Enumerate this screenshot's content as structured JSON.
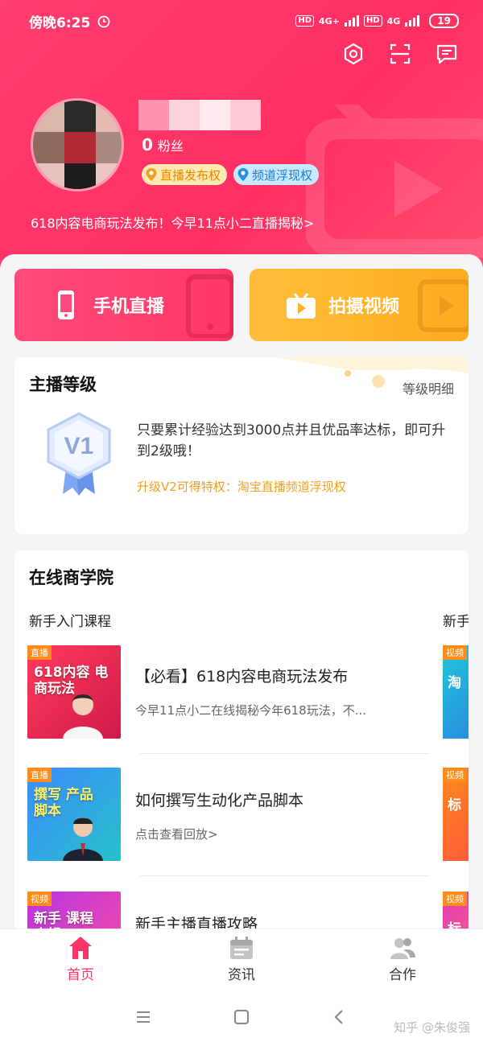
{
  "status_bar": {
    "time": "傍晚6:25",
    "hd1": "HD",
    "net1": "4G+",
    "hd2": "HD",
    "net2": "4G",
    "battery": "19"
  },
  "profile": {
    "fans_count": "0",
    "fans_label": "粉丝",
    "tags": [
      {
        "label": "直播发布权",
        "color": "#e78a00"
      },
      {
        "label": "频道浮现权",
        "color": "#1a7fd0"
      }
    ],
    "notice": "618内容电商玩法发布！今早11点小二直播揭秘>"
  },
  "actions": {
    "live_label": "手机直播",
    "video_label": "拍摄视频"
  },
  "level_card": {
    "title": "主播等级",
    "detail_link": "等级明细",
    "badge": "V1",
    "description": "只要累计经验达到3000点并且优品率达标，即可升到2级哦！",
    "perk": "升级V2可得特权：淘宝直播频道浮现权"
  },
  "academy": {
    "title": "在线商学院",
    "section": "新手入门课程",
    "section_next": "新手",
    "courses": [
      {
        "tag": "直播",
        "cover_text": "618内容 电商玩法",
        "title": "【必看】618内容电商玩法发布",
        "subtitle": "今早11点小二在线揭秘今年618玩法，不..."
      },
      {
        "tag": "直播",
        "cover_text": "撰写 产品脚本",
        "title": "如何撰写生动化产品脚本",
        "subtitle": "点击查看回放>"
      },
      {
        "tag": "视频",
        "cover_text": "新手 课程合辑",
        "title": "新手主播直播攻略",
        "subtitle": ""
      }
    ],
    "peek_tags": [
      "视频",
      "视频",
      "视频"
    ],
    "peek_texts": [
      "淘",
      "标",
      "标"
    ]
  },
  "tabbar": {
    "items": [
      {
        "label": "首页",
        "icon": "home-icon"
      },
      {
        "label": "资讯",
        "icon": "news-icon"
      },
      {
        "label": "合作",
        "icon": "people-icon"
      }
    ]
  },
  "watermark": "知乎 @朱俊强",
  "colors": {
    "header": "#ff3d6e",
    "accent": "#ff3366",
    "video_button": "#ffb22c",
    "perk_text": "#f0a020"
  }
}
